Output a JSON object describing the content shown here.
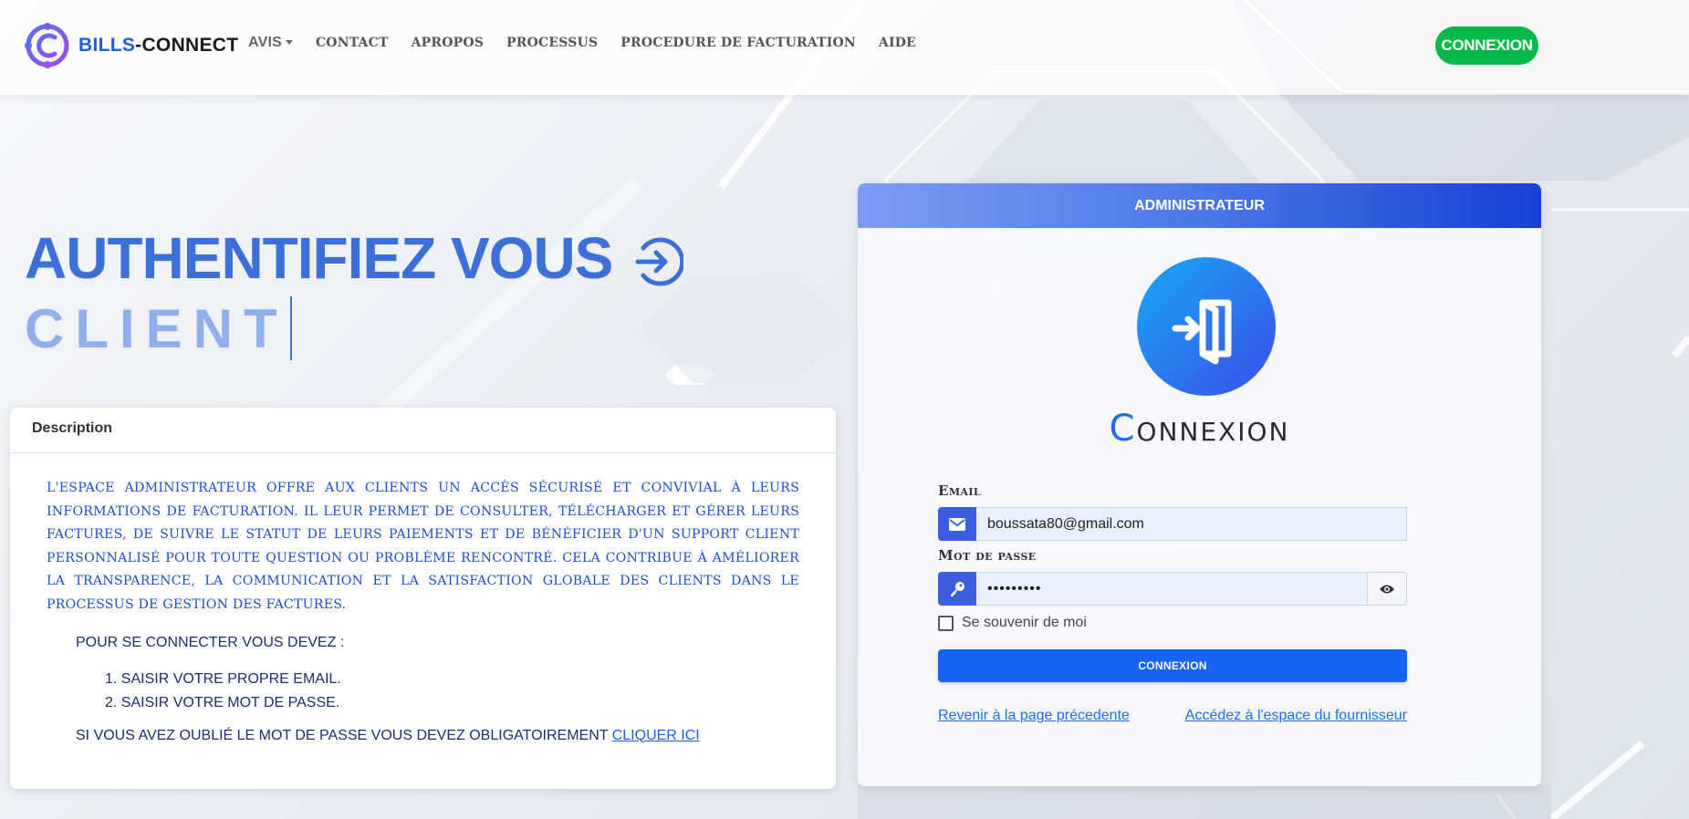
{
  "brand": {
    "part1": "BILLS",
    "part2": "-CONNECT"
  },
  "nav": {
    "items": [
      "AVIS",
      "CONTACT",
      "APROPOS",
      "PROCESSUS",
      "PROCEDURE DE FACTURATION",
      "AIDE"
    ],
    "login_button": "CONNEXION"
  },
  "hero": {
    "title": "AUTHENTIFIEZ VOUS",
    "subtitle": "CLIENT"
  },
  "description": {
    "header": "Description",
    "paragraph": "L'espace administrateur offre aux clients un accès sécurisé et convivial à leurs informations de facturation. Il leur permet de consulter, télécharger et gérer leurs factures, de suivre le statut de leurs paiements et de bénéficier d'un support client personnalisé pour toute question ou problème rencontré. Cela contribue à améliorer la transparence, la communication et la satisfaction globale des clients dans le processus de gestion des factures.",
    "lead": "POUR SE CONNECTER VOUS DEVEZ :",
    "steps": [
      "1. SAISIR VOTRE PROPRE EMAIL.",
      "2. SAISIR VOTRE MOT DE PASSE."
    ],
    "forgot_text": "SI VOUS AVEZ OUBLIÉ LE MOT DE PASSE VOUS DEVEZ OBLIGATOIREMENT ",
    "forgot_link": "CLIQUER ICI"
  },
  "login": {
    "header": "ADMINISTRATEUR",
    "title_first": "C",
    "title_rest": "onnexion",
    "email_label": "Email",
    "email_value": "boussata80@gmail.com",
    "password_label": "Mot de passe",
    "password_value": "•••••••••",
    "remember_label": "Se souvenir de moi",
    "submit_label": "CONNEXION",
    "back_link": "Revenir à la page précedente",
    "supplier_link": "Accédez à l'espace du fournisseur"
  },
  "colors": {
    "brand_blue": "#1d5fd8",
    "login_green": "#07b94a",
    "submit_blue": "#1764f2",
    "hero_blue": "#3d6fd9"
  },
  "icons": [
    "logo-icon",
    "login-arrow-icon",
    "door-enter-icon",
    "envelope-icon",
    "key-icon",
    "eye-icon",
    "caret-down-icon"
  ]
}
